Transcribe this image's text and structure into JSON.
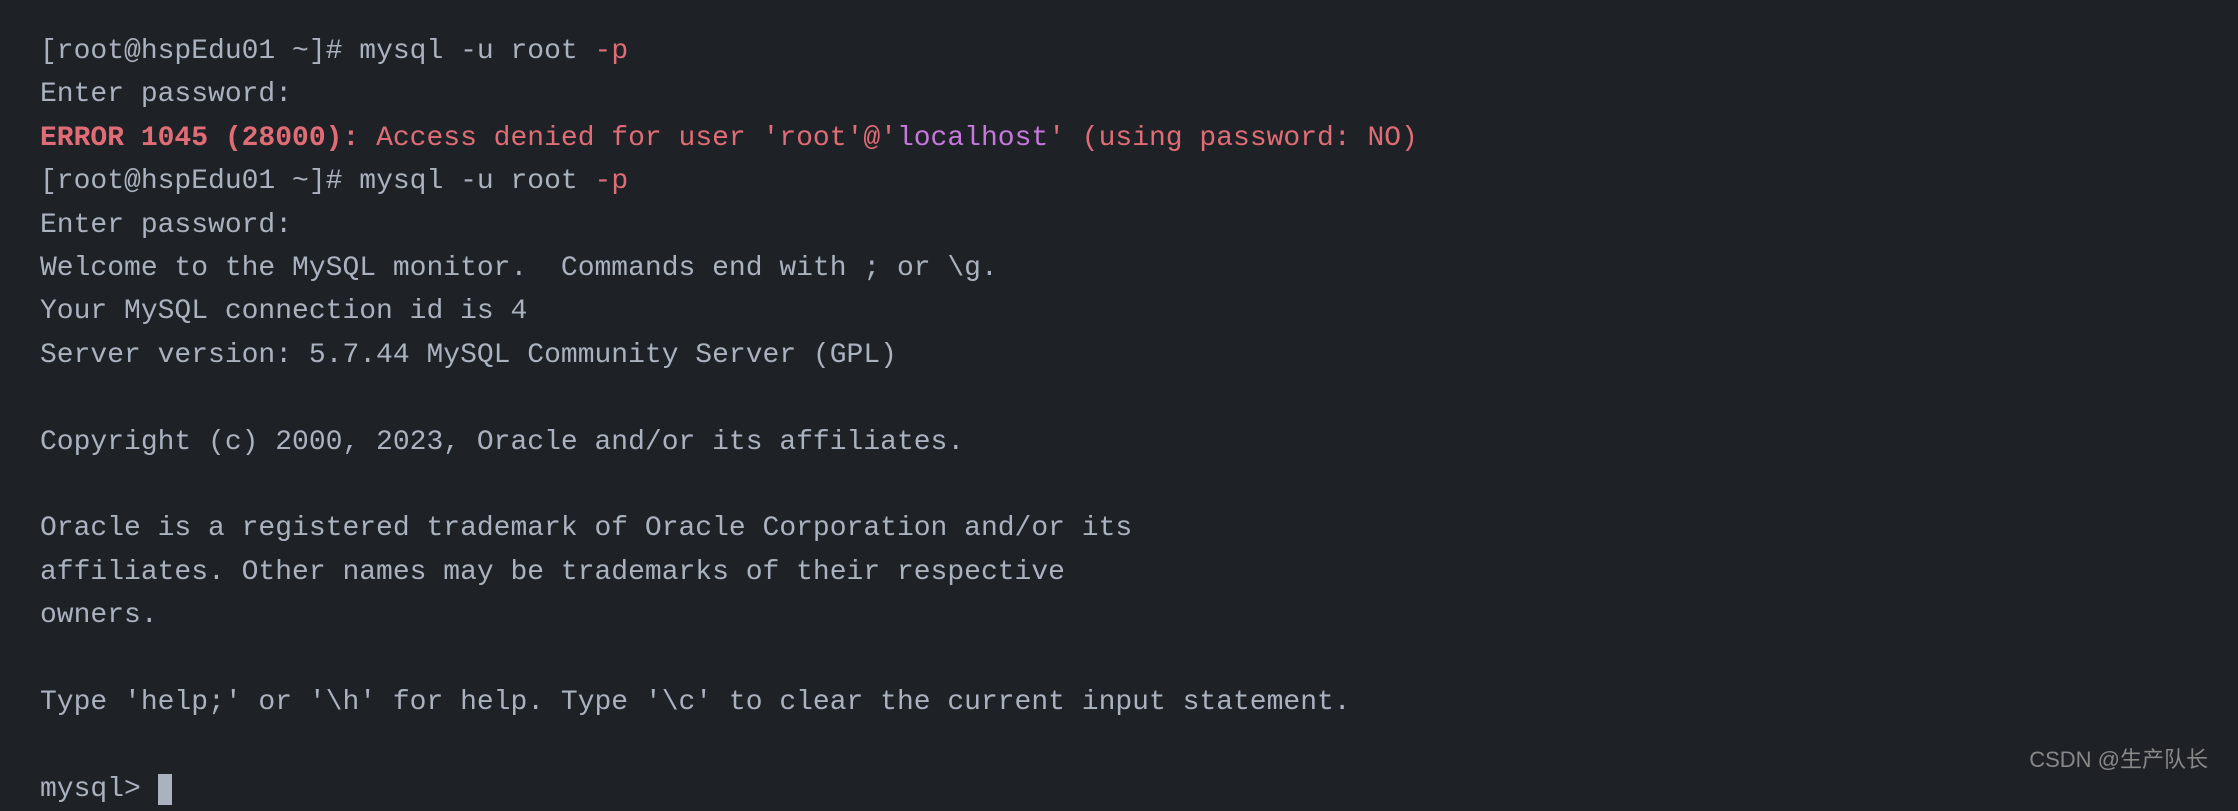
{
  "terminal": {
    "background": "#1e2227",
    "lines": [
      {
        "id": "line1",
        "type": "command",
        "parts": [
          {
            "text": "[root@hspEdu01 ~]# ",
            "style": "prompt"
          },
          {
            "text": "mysql ",
            "style": "normal"
          },
          {
            "text": "-u",
            "style": "normal"
          },
          {
            "text": " root ",
            "style": "normal"
          },
          {
            "text": "-p",
            "style": "flag"
          }
        ]
      },
      {
        "id": "line2",
        "type": "output",
        "text": "Enter password:",
        "style": "normal"
      },
      {
        "id": "line3",
        "type": "error",
        "parts": [
          {
            "text": "ERROR 1045 (28000): ",
            "style": "error-label"
          },
          {
            "text": "Access denied",
            "style": "access-denied"
          },
          {
            "text": " for user ",
            "style": "error-red"
          },
          {
            "text": "'root'@'",
            "style": "error-red"
          },
          {
            "text": "localhost",
            "style": "localhost"
          },
          {
            "text": "' (using password: NO)",
            "style": "error-red"
          }
        ]
      },
      {
        "id": "line4",
        "type": "command",
        "parts": [
          {
            "text": "[root@hspEdu01 ~]# ",
            "style": "prompt"
          },
          {
            "text": "mysql ",
            "style": "normal"
          },
          {
            "text": "-u",
            "style": "normal"
          },
          {
            "text": " root ",
            "style": "normal"
          },
          {
            "text": "-p",
            "style": "flag"
          }
        ]
      },
      {
        "id": "line5",
        "type": "output",
        "text": "Enter password:",
        "style": "normal"
      },
      {
        "id": "line6",
        "type": "output",
        "text": "Welcome to the MySQL monitor.  Commands end with ; or \\g.",
        "style": "normal"
      },
      {
        "id": "line7",
        "type": "output",
        "text": "Your MySQL connection id is 4",
        "style": "normal"
      },
      {
        "id": "line8",
        "type": "output",
        "text": "Server version: 5.7.44 MySQL Community Server (GPL)",
        "style": "normal"
      },
      {
        "id": "blank1",
        "type": "blank"
      },
      {
        "id": "line9",
        "type": "output",
        "text": "Copyright (c) 2000, 2023, Oracle and/or its affiliates.",
        "style": "normal"
      },
      {
        "id": "blank2",
        "type": "blank"
      },
      {
        "id": "line10",
        "type": "output",
        "text": "Oracle is a registered trademark of Oracle Corporation and/or its",
        "style": "normal"
      },
      {
        "id": "line11",
        "type": "output",
        "text": "affiliates. Other names may be trademarks of their respective",
        "style": "normal"
      },
      {
        "id": "line12",
        "type": "output",
        "text": "owners.",
        "style": "normal"
      },
      {
        "id": "blank3",
        "type": "blank"
      },
      {
        "id": "line13",
        "type": "output",
        "text": "Type 'help;' or '\\h' for help. Type '\\c' to clear the current input statement.",
        "style": "normal"
      },
      {
        "id": "blank4",
        "type": "blank"
      },
      {
        "id": "line14",
        "type": "prompt-line",
        "text": "mysql> ",
        "style": "normal",
        "has_cursor": true
      }
    ]
  },
  "watermark": {
    "text": "CSDN @生产队长"
  }
}
